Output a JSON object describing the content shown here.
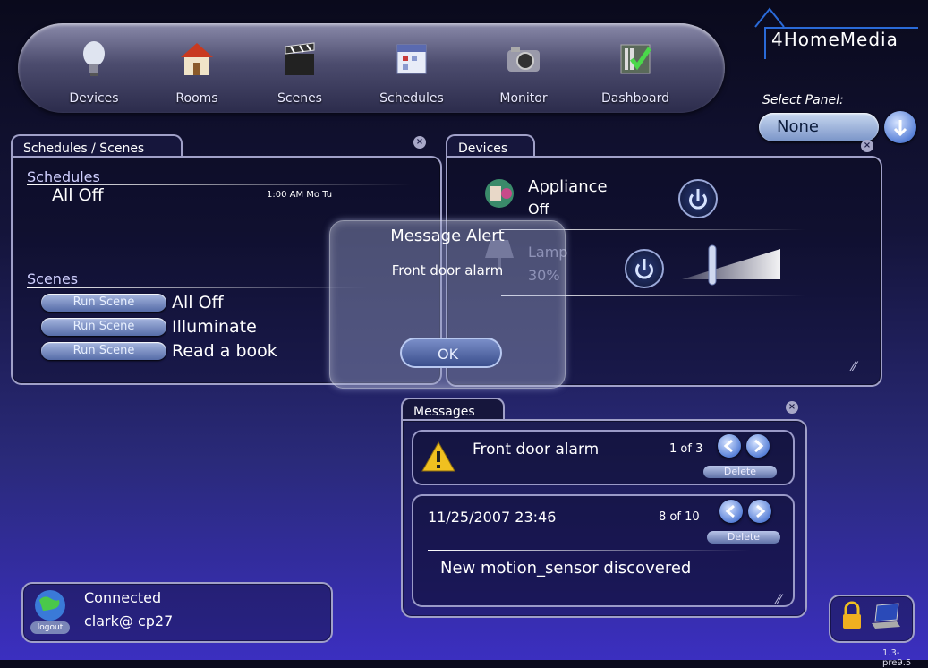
{
  "nav": {
    "items": [
      {
        "label": "Devices",
        "icon": "lightbulb-icon"
      },
      {
        "label": "Rooms",
        "icon": "house-icon"
      },
      {
        "label": "Scenes",
        "icon": "clapperboard-icon"
      },
      {
        "label": "Schedules",
        "icon": "calendar-icon"
      },
      {
        "label": "Monitor",
        "icon": "camera-icon"
      },
      {
        "label": "Dashboard",
        "icon": "dashboard-icon"
      }
    ]
  },
  "brand": {
    "logo": "4HomeMedia"
  },
  "panel_select": {
    "label": "Select Panel:",
    "value": "None"
  },
  "schedules_panel": {
    "tab": "Schedules / Scenes",
    "schedules_title": "Schedules",
    "schedules": [
      {
        "name": "All Off",
        "time": "1:00 AM Mo Tu"
      }
    ],
    "scenes_title": "Scenes",
    "run_label": "Run Scene",
    "scenes": [
      "All Off",
      "Illuminate",
      "Read a book"
    ]
  },
  "devices_panel": {
    "tab": "Devices",
    "devices": [
      {
        "name": "Appliance",
        "state": "Off"
      },
      {
        "name": "Lamp",
        "state": "30%",
        "level": 0.3
      }
    ]
  },
  "alert": {
    "title": "Message Alert",
    "text": "Front door alarm",
    "ok": "OK"
  },
  "messages_panel": {
    "tab": "Messages",
    "alert_message": {
      "text": "Front door alarm",
      "counter": "1 of 3",
      "delete": "Delete"
    },
    "event_message": {
      "timestamp": "11/25/2007 23:46",
      "counter": "8 of 10",
      "delete": "Delete",
      "text": "New motion_sensor discovered"
    }
  },
  "status": {
    "state": "Connected",
    "user": "clark@ cp27",
    "logout": "logout"
  },
  "version": "1.3-pre9.5",
  "colors": {
    "accent": "#5a82d8",
    "panel_border": "#a0a0c8",
    "alert_yellow": "#f0c020"
  }
}
